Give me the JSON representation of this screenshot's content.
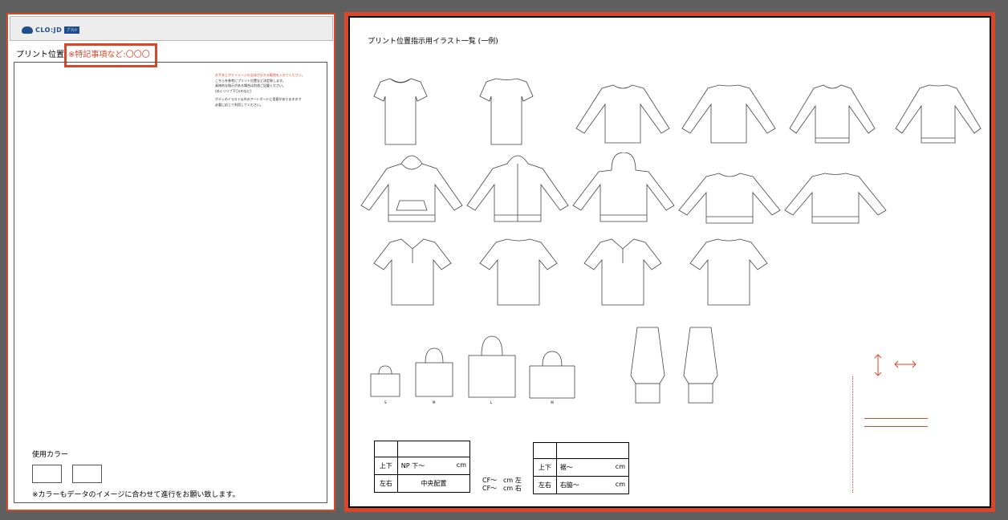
{
  "left_board": {
    "logo_text": "CLO:JD",
    "logo_badge": "ﾌﾟﾘﾝﾄ",
    "print_position_label": "プリント位置",
    "special_notes": "※特記事項など:〇〇〇",
    "instructions": {
      "line1": "お手本上がりイメージの全体が分かる範囲を入れてください。",
      "line2": "こちらを参考にプリント位置など決定致します。",
      "line3": "具体的な指示がある場合は別途ご記載ください。",
      "line4": "(丼ぐリリブ下〇cmなど)",
      "line5": "ボディのイラスト以外のアートボードに用意がありますので",
      "line6": "必要に応じて利用してください。"
    },
    "colors_label": "使用カラー",
    "color_note": "※カラーもデータのイメージに合わせて進行をお願い致します。"
  },
  "right_board": {
    "title": "プリント位置指示用イラスト一覧 (一例)",
    "bag_sizes": [
      "S",
      "M",
      "L",
      "W"
    ],
    "table1": {
      "row1_head": "上下",
      "row1_value": "NP 下～",
      "row1_unit": "cm",
      "row2_head": "左右",
      "row2_value": "中央配置"
    },
    "table2": {
      "row1_head": "上下",
      "row1_value": "裾～",
      "row1_unit": "cm",
      "row2_head": "左右",
      "row2_value": "右脇～",
      "row2_unit": "cm"
    },
    "cf_note_1": "CF～",
    "cf_note_2": "CF～",
    "cf_dir_1": "cm 左",
    "cf_dir_2": "cm 右"
  },
  "colors": {
    "accent": "#d9462a",
    "board_bg": "#ffffff",
    "workspace_bg": "#5f5f5f"
  }
}
